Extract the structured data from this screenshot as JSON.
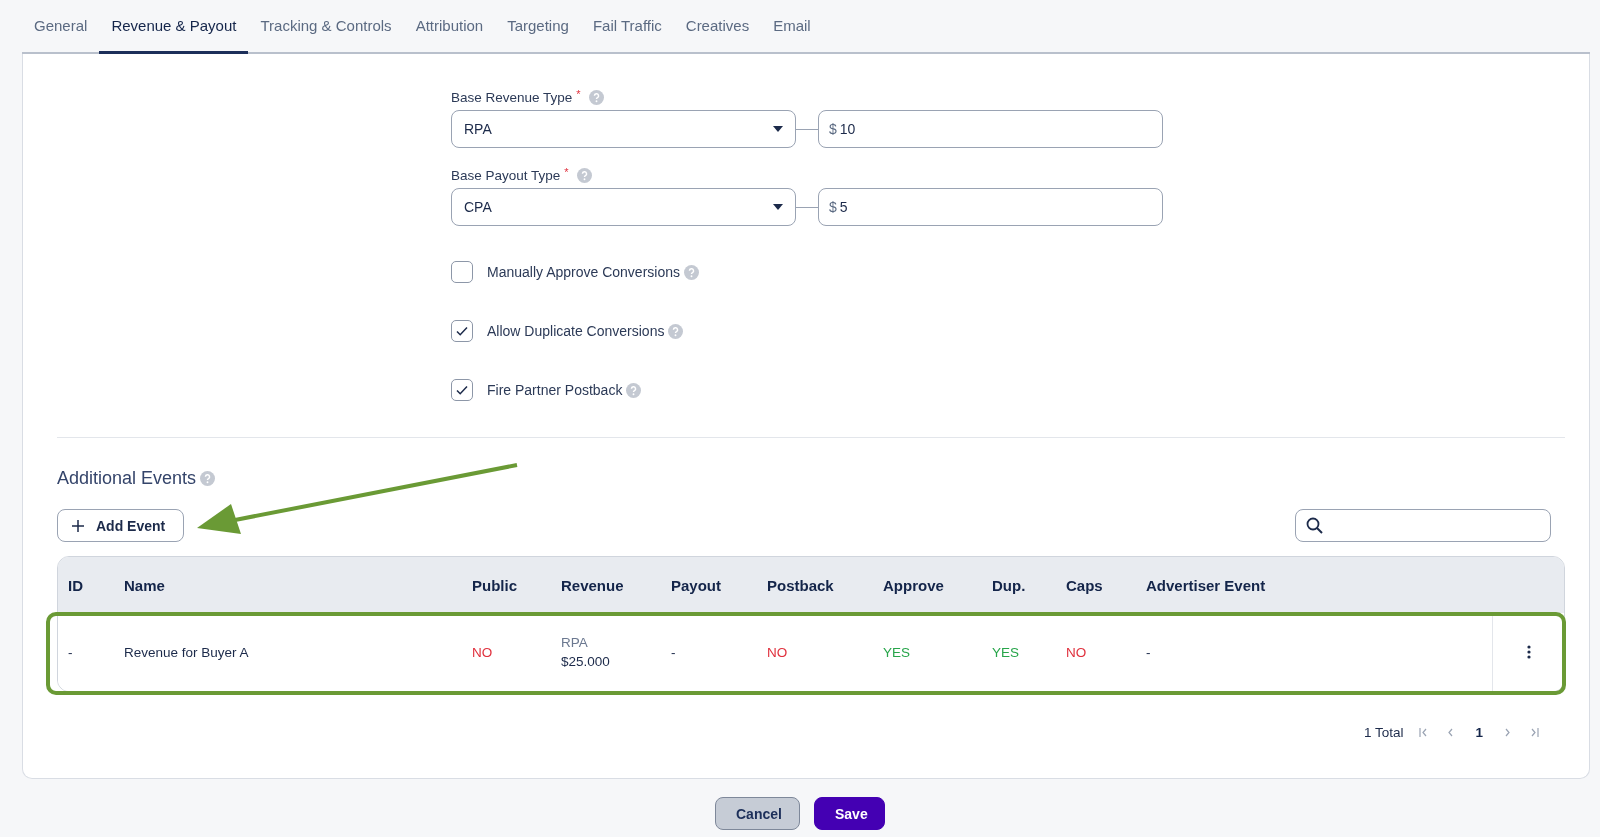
{
  "tabs": [
    {
      "label": "General",
      "selected": false
    },
    {
      "label": "Revenue & Payout",
      "selected": true
    },
    {
      "label": "Tracking & Controls",
      "selected": false
    },
    {
      "label": "Attribution",
      "selected": false
    },
    {
      "label": "Targeting",
      "selected": false
    },
    {
      "label": "Fail Traffic",
      "selected": false
    },
    {
      "label": "Creatives",
      "selected": false
    },
    {
      "label": "Email",
      "selected": false
    }
  ],
  "type_fields": [
    {
      "label": "Base Revenue Type",
      "required_mark": "*",
      "select_value": "RPA",
      "currency": "$",
      "amount": "10"
    },
    {
      "label": "Base Payout Type",
      "required_mark": "*",
      "select_value": "CPA",
      "currency": "$",
      "amount": "5"
    }
  ],
  "checkboxes": [
    {
      "label": "Manually Approve Conversions",
      "checked": false
    },
    {
      "label": "Allow Duplicate Conversions",
      "checked": true
    },
    {
      "label": "Fire Partner Postback",
      "checked": true
    }
  ],
  "additional_events": {
    "title": "Additional Events",
    "add_button": "Add Event",
    "table": {
      "columns": [
        "ID",
        "Name",
        "Public",
        "Revenue",
        "Payout",
        "Postback",
        "Approve",
        "Dup.",
        "Caps",
        "Advertiser Event"
      ],
      "rows": [
        {
          "cells": [
            {
              "kind": "text",
              "text": "-"
            },
            {
              "kind": "text",
              "text": "Revenue for Buyer A"
            },
            {
              "kind": "flag",
              "text": "NO",
              "on": false
            },
            {
              "kind": "stacked",
              "top": "RPA",
              "text": "$25.000"
            },
            {
              "kind": "text",
              "text": "-"
            },
            {
              "kind": "flag",
              "text": "NO",
              "on": false
            },
            {
              "kind": "flag",
              "text": "YES",
              "on": true
            },
            {
              "kind": "flag",
              "text": "YES",
              "on": true
            },
            {
              "kind": "flag",
              "text": "NO",
              "on": false
            },
            {
              "kind": "text",
              "text": "-"
            }
          ]
        }
      ]
    },
    "pagination": {
      "total": "1 Total",
      "pages": [
        {
          "label": "1",
          "selected": true
        }
      ]
    }
  },
  "footer_buttons": [
    {
      "label": "Cancel",
      "kind": "secondary"
    },
    {
      "label": "Save",
      "kind": "primary"
    }
  ]
}
